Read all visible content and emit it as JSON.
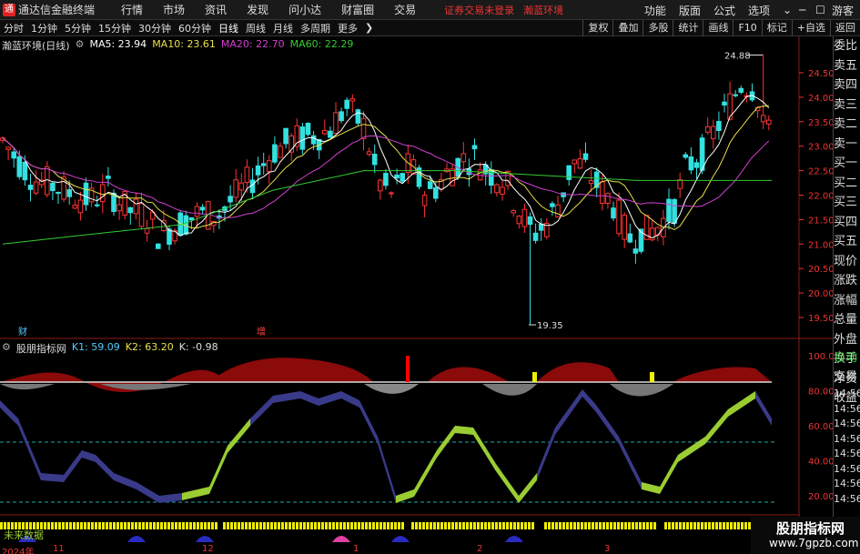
{
  "menubar": {
    "app_name": "通达信金融终端",
    "items": [
      "行情",
      "市场",
      "资讯",
      "发现",
      "问小达",
      "财富圈",
      "交易"
    ],
    "notice": "证券交易未登录",
    "stock_link": "瀚蓝环境",
    "right_items": [
      "功能",
      "版面",
      "公式",
      "选项"
    ],
    "guest": "游客"
  },
  "toolbar": {
    "periods": [
      "分时",
      "1分钟",
      "5分钟",
      "15分钟",
      "30分钟",
      "60分钟",
      "日线",
      "周线",
      "月线",
      "多周期",
      "更多"
    ],
    "active_period": "日线",
    "right_buttons": [
      "复权",
      "叠加",
      "多股",
      "统计",
      "画线",
      "F10",
      "标记",
      "+自选",
      "返回"
    ]
  },
  "main_chart": {
    "stock_title": "瀚蓝环境(日线)",
    "ma5_label": "MA5: 23.94",
    "ma10_label": "MA10: 23.61",
    "ma20_label": "MA20: 22.70",
    "ma60_label": "MA60: 22.29",
    "high_marker": "24.88",
    "low_marker": "19.35",
    "event_labels": [
      "财",
      "增"
    ],
    "price_ticks": [
      "24.50",
      "24.00",
      "23.50",
      "23.00",
      "22.50",
      "22.00",
      "21.50",
      "21.00",
      "20.50",
      "20.00",
      "19.50"
    ]
  },
  "indicator": {
    "title": "股朋指标网",
    "k1_label": "K1: 59.09",
    "k2_label": "K2: 63.20",
    "k_label": "K: -0.98",
    "ticks": [
      "100.0",
      "80.00",
      "60.00",
      "40.00",
      "20.00"
    ],
    "bottom_text": "未来数据"
  },
  "side_panel": {
    "top_items": [
      "委比",
      "卖五",
      "卖四",
      "卖三",
      "卖二",
      "卖一",
      "买一",
      "买二",
      "买三",
      "买四",
      "买五",
      "现价",
      "涨跌",
      "涨幅",
      "总量",
      "外盘",
      "换手",
      "净资",
      "收益"
    ],
    "bottom_items": [
      "自动",
      "交易",
      "14:56",
      "14:56",
      "14:56",
      "14:56",
      "14:56",
      "14:56",
      "14:56",
      "14:56"
    ]
  },
  "dates": [
    "2024年",
    "11",
    "12",
    "1",
    "2",
    "3"
  ],
  "watermark": {
    "line1": "股朋指标网",
    "line2": "www.7gpzb.com"
  },
  "colors": {
    "up": "#ff3333",
    "down": "#33e0e0",
    "ma5": "#ffffff",
    "ma10": "#e8e04a",
    "ma20": "#d040d0",
    "ma60": "#33cc33"
  }
}
